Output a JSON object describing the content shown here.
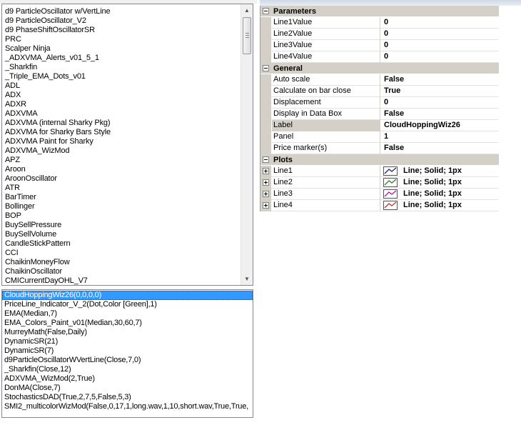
{
  "indicator_list": {
    "items": [
      "d9 ParticleOscillator w/VertLine",
      "d9 ParticleOscillator_V2",
      "d9 PhaseShiftOscillatorSR",
      "PRC",
      "Scalper Ninja",
      "_ADXVMA_Alerts_v01_5_1",
      "_Sharkfin",
      "_Triple_EMA_Dots_v01",
      "ADL",
      "ADX",
      "ADXR",
      "ADXVMA",
      "ADXVMA (internal Sharky Pkg)",
      "ADXVMA for Sharky Bars Style",
      "ADXVMA Paint for Sharky",
      "ADXVMA_WizMod",
      "APZ",
      "Aroon",
      "AroonOscillator",
      "ATR",
      "BarTimer",
      "Bollinger",
      "BOP",
      "BuySellPressure",
      "BuySellVolume",
      "CandleStickPattern",
      "CCI",
      "ChaikinMoneyFlow",
      "ChaikinOscillator",
      "CMICurrentDayOHL_V7"
    ],
    "scroll_up_icon": "scroll-up-arrow",
    "scroll_down_icon": "scroll-down-arrow"
  },
  "configured_list": {
    "items": [
      "CloudHoppingWiz26(0,0,0,0)",
      "PriceLine_Indicator_V_2(Dot,Color [Green],1)",
      "EMA(Median,7)",
      "EMA_Colors_Paint_v01(Median,30,60,7)",
      "MurreyMath(False,Daily)",
      "DynamicSR(21)",
      "DynamicSR(7)",
      "d9ParticleOscillatorWVertLine(Close,7,0)",
      "_Sharkfin(Close,12)",
      "ADXVMA_WizMod(2,True)",
      "DonMA(Close,7)",
      "StochasticsDAD(True,2,7,5,False,5,3)",
      "SMI2_multicolorWizMod(False,0,17,1,long.wav,1,10,short.wav,True,True,"
    ],
    "selected_index": 0
  },
  "property_grid": {
    "categories": [
      {
        "title": "Parameters",
        "rows": [
          {
            "name": "Line1Value",
            "value": "0"
          },
          {
            "name": "Line2Value",
            "value": "0"
          },
          {
            "name": "Line3Value",
            "value": "0"
          },
          {
            "name": "Line4Value",
            "value": "0"
          }
        ]
      },
      {
        "title": "General",
        "rows": [
          {
            "name": "Auto scale",
            "value": "False"
          },
          {
            "name": "Calculate on bar close",
            "value": "True"
          },
          {
            "name": "Displacement",
            "value": "0"
          },
          {
            "name": "Display in Data Box",
            "value": "False"
          },
          {
            "name": "Label",
            "value": "CloudHoppingWiz26"
          },
          {
            "name": "Panel",
            "value": "1"
          },
          {
            "name": "Price marker(s)",
            "value": "False"
          }
        ]
      },
      {
        "title": "Plots",
        "rows": [
          {
            "name": "Line1",
            "value": "Line; Solid; 1px",
            "color": "#1c2a6e"
          },
          {
            "name": "Line2",
            "value": "Line; Solid; 1px",
            "color": "#1f8a1f"
          },
          {
            "name": "Line3",
            "value": "Line; Solid; 1px",
            "color": "#b018b0"
          },
          {
            "name": "Line4",
            "value": "Line; Solid; 1px",
            "color": "#c83030"
          }
        ]
      }
    ],
    "selected_row": "Label"
  }
}
